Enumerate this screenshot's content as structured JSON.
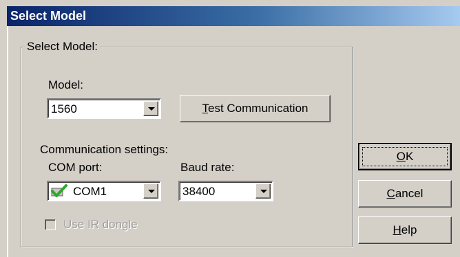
{
  "window": {
    "title": "Select Model"
  },
  "group": {
    "legend": "Select Model:"
  },
  "model": {
    "label": "Model:",
    "value": "1560"
  },
  "test_button": {
    "label_first": "T",
    "label_rest": "est Communication"
  },
  "comm": {
    "label": "Communication settings:"
  },
  "com_port": {
    "label": "COM port:",
    "value": "COM1",
    "status_icon": "check-mark-icon"
  },
  "baud_rate": {
    "label": "Baud rate:",
    "value": "38400"
  },
  "ir_dongle": {
    "label": "Use IR dongle",
    "checked": false,
    "enabled": false
  },
  "buttons": {
    "ok": {
      "mnemonic": "O",
      "rest": "K"
    },
    "cancel": {
      "mnemonic": "C",
      "rest": "ancel"
    },
    "help": {
      "mnemonic": "H",
      "rest": "elp"
    }
  },
  "colors": {
    "title_start": "#0a246a",
    "title_end": "#a6caf0",
    "face": "#d4d0c8",
    "check_green": "#2fa82a"
  }
}
